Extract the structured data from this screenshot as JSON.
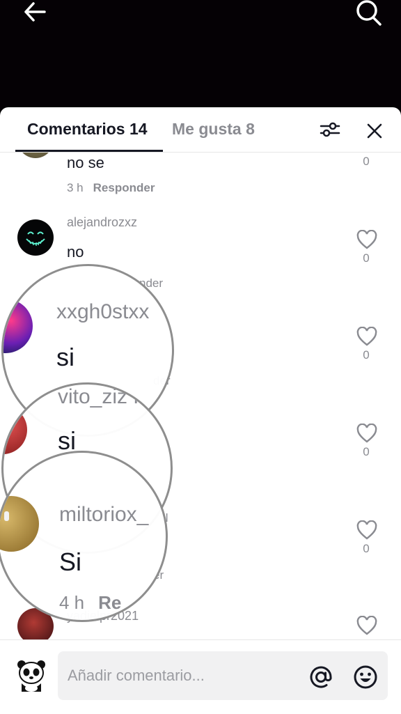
{
  "tabs": {
    "comments": "Comentarios 14",
    "likes": "Me gusta 8"
  },
  "comments": [
    {
      "username": "",
      "text": "no se",
      "time": "3 h",
      "reply": "Responder",
      "likes": "0"
    },
    {
      "username": "alejandrozxz",
      "text": "no",
      "likes": "0"
    },
    {
      "username": "xxgh0stxx",
      "text": "si",
      "likes": "0"
    },
    {
      "username": "vito_ziz R",
      "text": "si",
      "likes": "0"
    },
    {
      "username": "miltoriox_",
      "text": "Si",
      "time": "4 h",
      "reply": "Re",
      "likes": "0"
    },
    {
      "username": "yadielpr2021"
    }
  ],
  "peek": {
    "r1": "nder",
    "r2": "der",
    "r3": "ll",
    "r4": "er"
  },
  "input": {
    "placeholder": "Añadir comentario..."
  },
  "icons": {
    "back": "arrow-left-icon",
    "search": "search-icon",
    "filter": "sliders-icon",
    "close": "close-icon",
    "mention": "at-icon",
    "emoji": "emoji-icon"
  }
}
